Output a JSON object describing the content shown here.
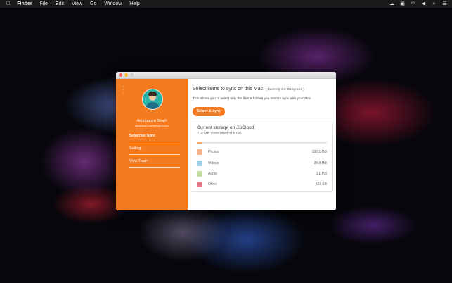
{
  "menubar": {
    "app_name": "Finder",
    "items": [
      "File",
      "Edit",
      "View",
      "Go",
      "Window",
      "Help"
    ],
    "status_icons": [
      "cloud-icon",
      "dropbox-icon",
      "wifi-icon",
      "volume-icon",
      "search-icon",
      "list-icon"
    ]
  },
  "sidebar": {
    "user_name": "Abhimanyu Singh",
    "user_email": "abhimanyu.ramesh@ril.com",
    "nav": [
      "Selective Sync",
      "Setting",
      "View Trash"
    ]
  },
  "main": {
    "heading": "Select items to sync on this Mac",
    "heading_sub": "( Currently 8.9 MB synced )",
    "description": "This allows you to select only the files & folders you want to sync with your Mac",
    "sync_button": "Select & sync"
  },
  "storage": {
    "title": "Current storage on JioCloud",
    "used_text": "214 MB consumed of 5 GB",
    "used_fraction": 0.042,
    "colors": {
      "bar_fill": "#f4a468",
      "track": "#e6e6e6"
    },
    "categories": [
      {
        "label": "Photos",
        "value": "182.1 MB",
        "color": "#f9b48a"
      },
      {
        "label": "Videos",
        "value": "29.9 MB",
        "color": "#9fcfe8"
      },
      {
        "label": "Audio",
        "value": "3.1 MB",
        "color": "#c2dea0"
      },
      {
        "label": "Other",
        "value": "437 KB",
        "color": "#e07a8a"
      }
    ]
  },
  "accent_color": "#f47b20"
}
